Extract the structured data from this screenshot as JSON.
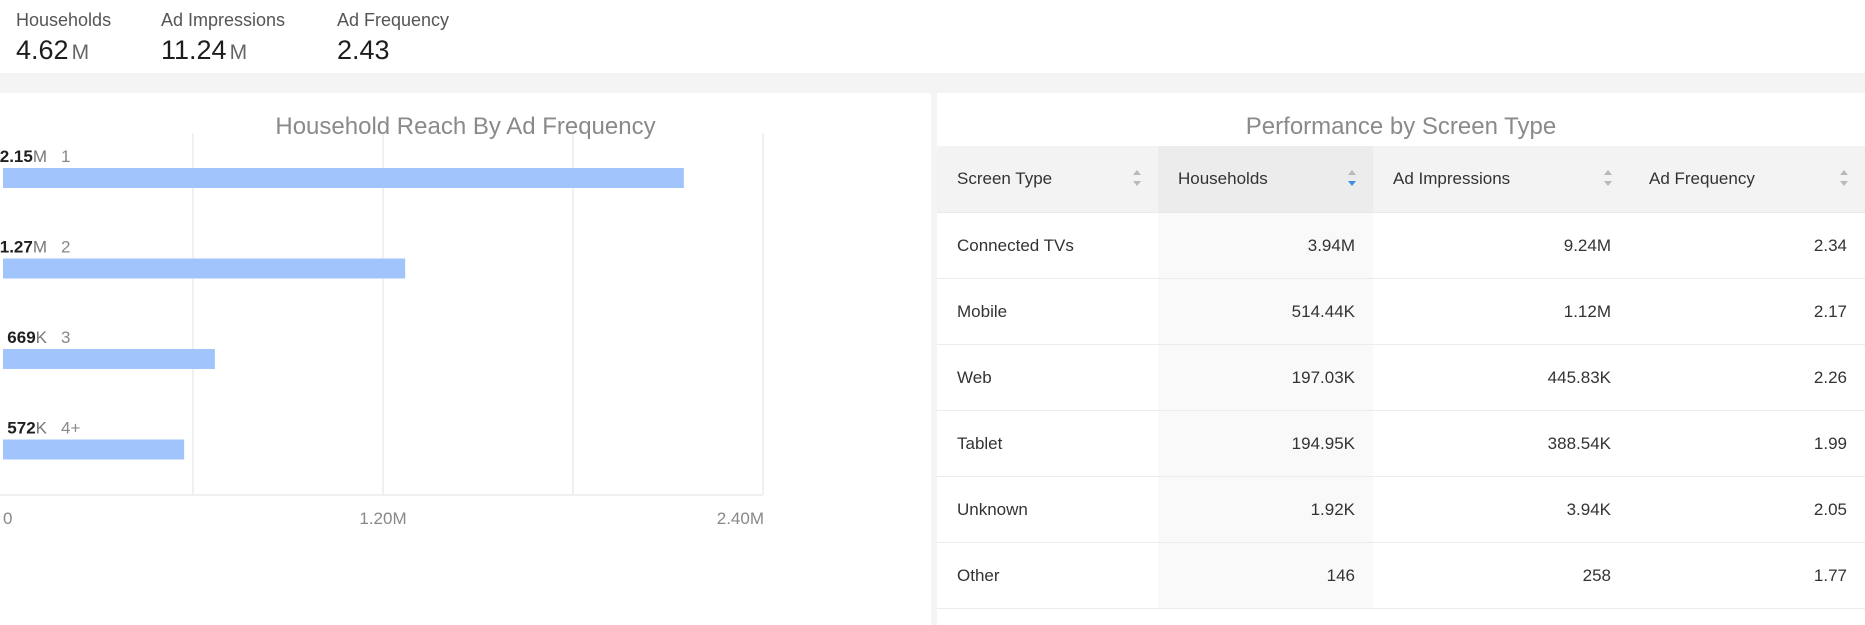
{
  "kpis": [
    {
      "label": "Households",
      "value": "4.62",
      "unit": "M"
    },
    {
      "label": "Ad Impressions",
      "value": "11.24",
      "unit": "M"
    },
    {
      "label": "Ad Frequency",
      "value": "2.43",
      "unit": ""
    }
  ],
  "chart": {
    "title": "Household Reach By Ad Frequency"
  },
  "chart_data": {
    "type": "bar",
    "orientation": "horizontal",
    "title": "Household Reach By Ad Frequency",
    "categories": [
      "1",
      "2",
      "3",
      "4+"
    ],
    "values": [
      2150000,
      1270000,
      669000,
      572000
    ],
    "value_labels": [
      {
        "num": "2.15",
        "unit": "M"
      },
      {
        "num": "1.27",
        "unit": "M"
      },
      {
        "num": "669",
        "unit": "K"
      },
      {
        "num": "572",
        "unit": "K"
      }
    ],
    "x_ticks": [
      {
        "value": 0,
        "label": "0"
      },
      {
        "value": 1200000,
        "label": "1.20M"
      },
      {
        "value": 2400000,
        "label": "2.40M"
      }
    ],
    "xlim": [
      0,
      2400000
    ],
    "grid": true,
    "bar_color": "#a0c4fb"
  },
  "table": {
    "title": "Performance by Screen Type",
    "columns": [
      "Screen Type",
      "Households",
      "Ad Impressions",
      "Ad Frequency"
    ],
    "sorted_column": "Households",
    "sort_color": "#3d8fe0",
    "rows": [
      [
        "Connected TVs",
        "3.94M",
        "9.24M",
        "2.34"
      ],
      [
        "Mobile",
        "514.44K",
        "1.12M",
        "2.17"
      ],
      [
        "Web",
        "197.03K",
        "445.83K",
        "2.26"
      ],
      [
        "Tablet",
        "194.95K",
        "388.54K",
        "1.99"
      ],
      [
        "Unknown",
        "1.92K",
        "3.94K",
        "2.05"
      ],
      [
        "Other",
        "146",
        "258",
        "1.77"
      ]
    ]
  }
}
